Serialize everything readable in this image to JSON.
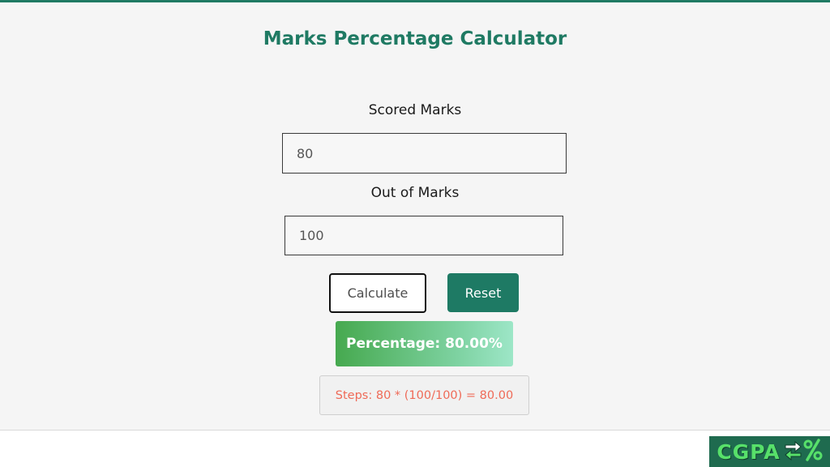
{
  "calculator": {
    "title": "Marks Percentage Calculator",
    "scored_label": "Scored Marks",
    "scored_value": "80",
    "out_of_label": "Out of Marks",
    "out_of_value": "100",
    "calculate_label": "Calculate",
    "reset_label": "Reset",
    "result_text": "Percentage: 80.00%",
    "steps_text": "Steps: 80 * (100/100) = 80.00"
  },
  "logo": {
    "text": "CGPA",
    "icon": "arrows-percent-icon"
  },
  "colors": {
    "accent": "#1f7a63",
    "result_gradient_start": "#46a94f",
    "result_gradient_end": "#9de6c7",
    "steps_text": "#ef6a57",
    "logo_bg": "#1f6b4f",
    "logo_text": "#57e06a"
  }
}
